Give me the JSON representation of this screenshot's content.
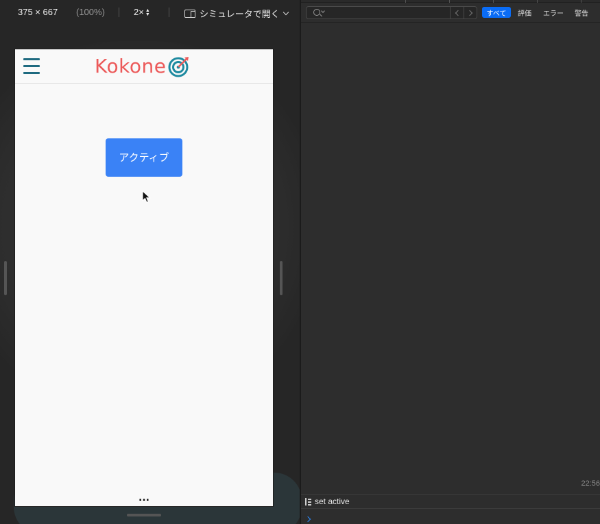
{
  "responsive_toolbar": {
    "dimensions": "375 × 667",
    "zoom": "(100%)",
    "pixel_ratio": "2×",
    "simulator_label": "シミュレータで開く"
  },
  "app": {
    "logo_text": "Kokone",
    "logo_colors": {
      "text": "#ec5a5a",
      "ring": "#1e8aa0",
      "arrow": "#ec5a5a"
    },
    "menu_color": "#1e6a80",
    "active_button_label": "アクティブ",
    "active_button_color": "#3a82f6",
    "more_label": "..."
  },
  "console": {
    "search_placeholder": "",
    "filters": [
      {
        "label": "すべて",
        "selected": true
      },
      {
        "label": "評価",
        "selected": false
      },
      {
        "label": "エラー",
        "selected": false
      },
      {
        "label": "警告",
        "selected": false
      }
    ],
    "timestamp": "22:56",
    "log_message": "set active",
    "prompt_value": ""
  }
}
